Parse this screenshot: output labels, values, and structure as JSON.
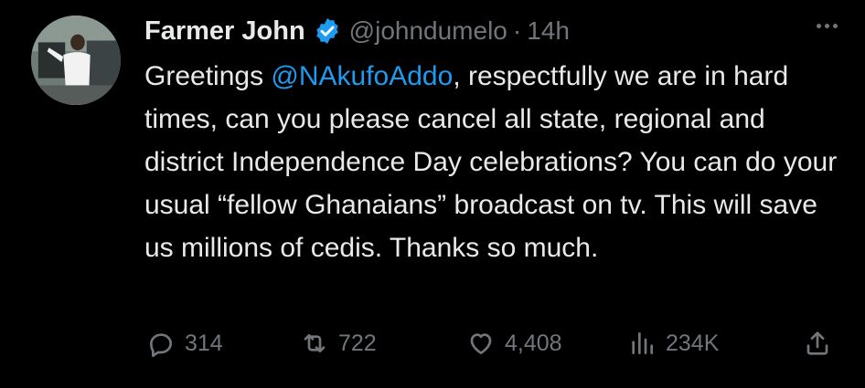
{
  "tweet": {
    "author_name": "Farmer John",
    "handle": "@johndumelo",
    "separator": "·",
    "time": "14h",
    "text_before": "Greetings ",
    "mention": "@NAkufoAddo",
    "text_after": ", respectfully we are in hard times, can you please cancel all state, regional and district Independence Day celebrations? You can do your usual “fellow Ghanaians” broadcast on tv. This will save us millions of cedis. Thanks so much."
  },
  "actions": {
    "replies": "314",
    "reposts": "722",
    "likes": "4,408",
    "views": "234K"
  },
  "icons": {
    "verified": "verified-badge-icon",
    "more": "more-options-icon",
    "reply": "reply-icon",
    "repost": "repost-icon",
    "like": "heart-icon",
    "views": "views-icon",
    "share": "share-icon"
  },
  "colors": {
    "background": "#000000",
    "text": "#e7e9ea",
    "muted": "#71767b",
    "accent": "#1d9bf0"
  }
}
